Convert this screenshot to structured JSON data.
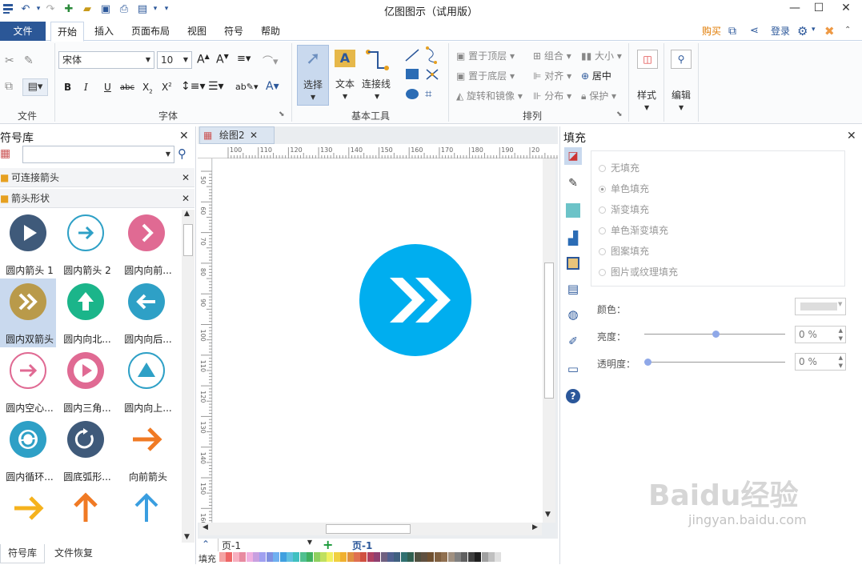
{
  "app": {
    "title": "亿图图示（试用版）"
  },
  "tabs": {
    "file": "文件",
    "start": "开始",
    "insert": "插入",
    "layout": "页面布局",
    "view": "视图",
    "symbol": "符号",
    "help": "帮助"
  },
  "topright": {
    "buy": "购买",
    "login": "登录"
  },
  "ribbon": {
    "groups": {
      "file": "文件",
      "font": "字体",
      "basic_tools": "基本工具",
      "arrange": "排列"
    },
    "font_name": "宋体",
    "font_size": "10",
    "tools": {
      "select": "选择",
      "text": "文本",
      "connector": "连接线"
    },
    "arrange": {
      "bring_front": "置于顶层",
      "send_back": "置于底层",
      "rotate": "旋转和镜像",
      "group": "组合",
      "align": "对齐",
      "distribute": "分布",
      "size": "大小",
      "center": "居中",
      "protect": "保护"
    },
    "style": "样式",
    "edit": "编辑"
  },
  "left_panel": {
    "title": "符号库",
    "search_placeholder": "",
    "categories": [
      "可连接箭头",
      "箭头形状"
    ],
    "shapes": [
      {
        "label": "圆内箭头 1",
        "color": "#3f5a7a",
        "glyph": "▶"
      },
      {
        "label": "圆内箭头 2",
        "color": "#ffffff",
        "glyph": "➜"
      },
      {
        "label": "圆内向前...",
        "color": "#e06a93",
        "glyph": "❯"
      },
      {
        "label": "圆内双箭头",
        "color": "#b99a4a",
        "glyph": "»"
      },
      {
        "label": "圆内向北...",
        "color": "#1bb58a",
        "glyph": "⬆"
      },
      {
        "label": "圆内向后...",
        "color": "#2ea0c6",
        "glyph": "⬅"
      },
      {
        "label": "圆内空心...",
        "color": "#ffffff",
        "glyph": "➔"
      },
      {
        "label": "圆内三角...",
        "color": "#e06a93",
        "glyph": "▷"
      },
      {
        "label": "圆内向上...",
        "color": "#ffffff",
        "glyph": "▲"
      },
      {
        "label": "圆内循环...",
        "color": "#2ea0c6",
        "glyph": "⟳"
      },
      {
        "label": "圆底弧形...",
        "color": "#3f5a7a",
        "glyph": "↻"
      },
      {
        "label": "向前箭头",
        "color": "#ffffff",
        "glyph": "➜"
      }
    ],
    "bottom_tabs": [
      "符号库",
      "文件恢复"
    ]
  },
  "document": {
    "tab_title": "绘图2",
    "page_name": "页-1",
    "page_tab": "页-1"
  },
  "ruler": {
    "h_ticks": [
      "100",
      "110",
      "120",
      "130",
      "140",
      "150",
      "160",
      "170",
      "180",
      "190",
      "20"
    ],
    "v_ticks": [
      "50",
      "60",
      "70",
      "80",
      "90",
      "100",
      "110",
      "120",
      "130",
      "140",
      "150",
      "160"
    ]
  },
  "canvas": {
    "shape_color": "#00aeef"
  },
  "fill_panel": {
    "title": "填充",
    "options": [
      "无填充",
      "单色填充",
      "渐变填充",
      "单色渐变填充",
      "图案填充",
      "图片或纹理填充"
    ],
    "color_label": "颜色：",
    "brightness_label": "亮度：",
    "brightness_value": "0 %",
    "transparency_label": "透明度：",
    "transparency_value": "0 %"
  },
  "statusbar": {
    "fill_label": "填充"
  },
  "watermark": {
    "brand": "Baidu经验",
    "url": "jingyan.baidu.com"
  }
}
